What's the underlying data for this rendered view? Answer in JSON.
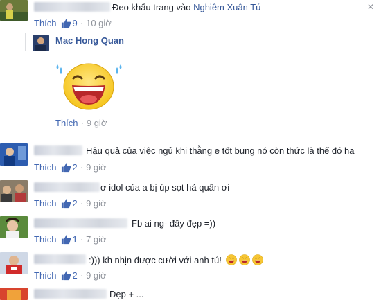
{
  "comments": [
    {
      "text_before": "Đeo khẩu trang vào ",
      "mention": "Nghiêm Xuân Tú",
      "like_label": "Thích",
      "like_count": "9",
      "time": "10 giờ"
    },
    {
      "reply_name": "Mac Hong Quan",
      "like_label": "Thích",
      "time": "9 giờ"
    },
    {
      "text": "Hậu quả của việc ngủ khi thằng e tốt bụng nó còn thức là thế đó ha",
      "like_label": "Thích",
      "like_count": "2",
      "time": "9 giờ"
    },
    {
      "text": "ơ idol của a bị úp sọt hả quân ơi",
      "like_label": "Thích",
      "like_count": "2",
      "time": "9 giờ"
    },
    {
      "text": "Fb ai ng- đấy đẹp =))",
      "like_label": "Thích",
      "like_count": "1",
      "time": "7 giờ"
    },
    {
      "text": ":))) kh nhịn được cười với anh tú!",
      "like_label": "Thích",
      "like_count": "2",
      "time": "9 giờ"
    },
    {
      "text": "Đẹp + ..."
    }
  ],
  "icons": {
    "like": "thumbs-up-icon",
    "laugh": "laughing-emoji-icon",
    "close": "close-icon"
  },
  "colors": {
    "link": "#365899",
    "meta": "#90949c",
    "like": "#4267b2"
  }
}
